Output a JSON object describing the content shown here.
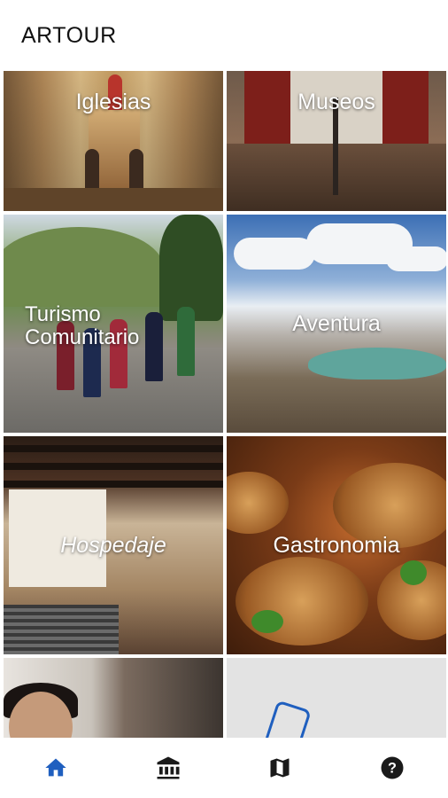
{
  "app": {
    "title": "ARTOUR"
  },
  "tiles": [
    {
      "label": "Iglesias"
    },
    {
      "label": "Museos"
    },
    {
      "label": "Turismo\nComunitario"
    },
    {
      "label": "Aventura"
    },
    {
      "label": "Hospedaje"
    },
    {
      "label": "Gastronomia"
    }
  ],
  "bottom_nav": {
    "items": [
      {
        "icon": "home-icon",
        "active": true
      },
      {
        "icon": "museum-icon",
        "active": false
      },
      {
        "icon": "map-icon",
        "active": false
      },
      {
        "icon": "help-icon",
        "active": false
      }
    ],
    "active_color": "#1f5fbf",
    "inactive_color": "#1a1a1a"
  }
}
